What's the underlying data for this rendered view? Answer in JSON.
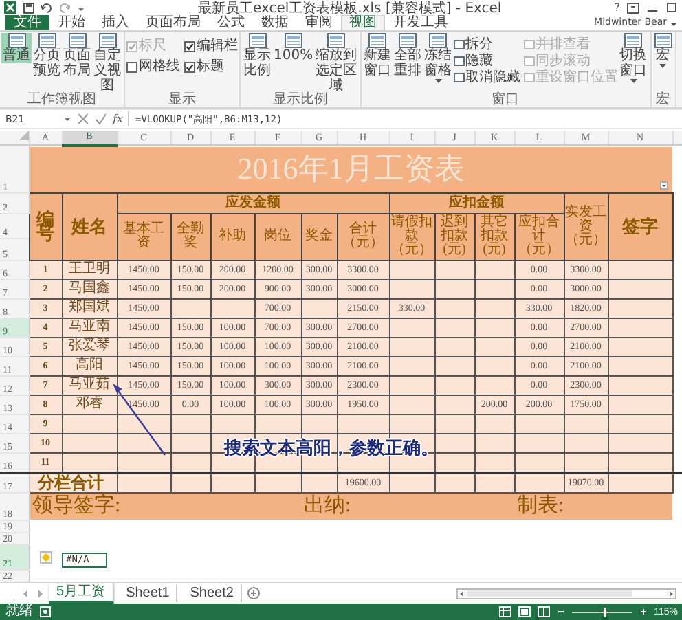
{
  "window": {
    "title": "最新员工excel工资表模板.xls  [兼容模式] - Excel",
    "help": "?"
  },
  "ribbon": {
    "tabs": [
      {
        "label": "文件",
        "kind": "file",
        "selected": false
      },
      {
        "label": "开始",
        "kind": "tab",
        "selected": false
      },
      {
        "label": "插入",
        "kind": "tab",
        "selected": false
      },
      {
        "label": "页面布局",
        "kind": "tab",
        "selected": false
      },
      {
        "label": "公式",
        "kind": "tab",
        "selected": false
      },
      {
        "label": "数据",
        "kind": "tab",
        "selected": false
      },
      {
        "label": "审阅",
        "kind": "tab",
        "selected": false
      },
      {
        "label": "视图",
        "kind": "tab",
        "selected": true
      },
      {
        "label": "开发工具",
        "kind": "tab",
        "selected": false
      }
    ],
    "account": "Midwinter Bear",
    "groups": [
      {
        "label": "工作簿视图",
        "items": [
          {
            "kind": "large",
            "label": "普通",
            "selected": true
          },
          {
            "kind": "large",
            "label": "分页预览",
            "selected": false
          },
          {
            "kind": "large",
            "label": "页面布局",
            "selected": false
          },
          {
            "kind": "large",
            "label": "自定义视图",
            "selected": false
          }
        ]
      },
      {
        "label": "显示",
        "items": [
          {
            "kind": "check",
            "label": "标尺",
            "checked": true,
            "disabled": true
          },
          {
            "kind": "check",
            "label": "编辑栏",
            "checked": true,
            "disabled": false
          },
          {
            "kind": "check",
            "label": "网格线",
            "checked": false,
            "disabled": false
          },
          {
            "kind": "check",
            "label": "标题",
            "checked": true,
            "disabled": false
          }
        ]
      },
      {
        "label": "显示比例",
        "items": [
          {
            "kind": "large",
            "label": "显示比例",
            "selected": false
          },
          {
            "kind": "large",
            "label": "100%",
            "selected": false
          },
          {
            "kind": "large",
            "label": "缩放到选定区域",
            "selected": false
          }
        ]
      },
      {
        "label": "窗口",
        "items": [
          {
            "kind": "large",
            "label": "新建窗口",
            "selected": false
          },
          {
            "kind": "large",
            "label": "全部重排",
            "selected": false
          },
          {
            "kind": "large",
            "label": "冻结窗格",
            "selected": false,
            "menu": true
          },
          {
            "kind": "small",
            "label": "拆分",
            "disabled": false
          },
          {
            "kind": "small",
            "label": "隐藏",
            "disabled": false
          },
          {
            "kind": "small",
            "label": "取消隐藏",
            "disabled": false
          },
          {
            "kind": "small",
            "label": "并排查看",
            "disabled": true
          },
          {
            "kind": "small",
            "label": "同步滚动",
            "disabled": true
          },
          {
            "kind": "small",
            "label": "重设窗口位置",
            "disabled": true
          },
          {
            "kind": "large",
            "label": "切换窗口",
            "selected": false,
            "menu": true
          }
        ]
      },
      {
        "label": "宏",
        "items": [
          {
            "kind": "large",
            "label": "宏",
            "selected": false,
            "menu": true
          }
        ]
      }
    ]
  },
  "formula_bar": {
    "name_box": "B21",
    "function_label": "fx",
    "formula": "=VLOOKUP(\"高阳\",B6:M13,12)"
  },
  "sheet": {
    "columns": [
      {
        "label": "A",
        "selected": false
      },
      {
        "label": "B",
        "selected": true
      },
      {
        "label": "C",
        "selected": false
      },
      {
        "label": "D",
        "selected": false
      },
      {
        "label": "E",
        "selected": false
      },
      {
        "label": "F",
        "selected": false
      },
      {
        "label": "G",
        "selected": false
      },
      {
        "label": "H",
        "selected": false
      },
      {
        "label": "I",
        "selected": false
      },
      {
        "label": "J",
        "selected": false
      },
      {
        "label": "K",
        "selected": false
      },
      {
        "label": "L",
        "selected": false
      },
      {
        "label": "M",
        "selected": false
      },
      {
        "label": "N",
        "selected": false
      }
    ],
    "title_row": {
      "number": "1",
      "title": "2016年1月工资表"
    },
    "header": {
      "row_numbers": [
        "2",
        "4",
        "5"
      ],
      "id_label": "编号",
      "name_label": "姓名",
      "pay_group": "应发金额",
      "deduct_group": "应扣金额",
      "net_label": "实发工资（元）",
      "sign_label": "签字",
      "pay_columns": [
        "基本工资",
        "全勤奖",
        "补助",
        "岗位",
        "奖金",
        "合计（元）"
      ],
      "deduct_columns": [
        "请假扣款（元）",
        "迟到扣款(元)",
        "其它扣款(元)",
        "应扣合计（元）"
      ]
    },
    "rows": [
      {
        "number": "6",
        "selected": false,
        "cells": [
          "1",
          "王卫明",
          "1450.00",
          "150.00",
          "200.00",
          "1200.00",
          "300.00",
          "3300.00",
          null,
          null,
          null,
          "0.00",
          "3300.00",
          null
        ]
      },
      {
        "number": "7",
        "selected": false,
        "cells": [
          "2",
          "马国鑫",
          "1450.00",
          "150.00",
          "200.00",
          "900.00",
          "300.00",
          "3000.00",
          null,
          null,
          null,
          "0.00",
          "3000.00",
          null
        ]
      },
      {
        "number": "8",
        "selected": false,
        "cells": [
          "3",
          "郑国斌",
          "1450.00",
          null,
          null,
          "700.00",
          null,
          "2150.00",
          "330.00",
          null,
          null,
          "330.00",
          "1820.00",
          null
        ]
      },
      {
        "number": "9",
        "selected": true,
        "cells": [
          "4",
          "马亚南",
          "1450.00",
          "150.00",
          "100.00",
          "700.00",
          "300.00",
          "2700.00",
          null,
          null,
          null,
          "0.00",
          "2700.00",
          null
        ]
      },
      {
        "number": "10",
        "selected": false,
        "cells": [
          "5",
          "张爱琴",
          "1450.00",
          "150.00",
          "100.00",
          "100.00",
          "300.00",
          "2100.00",
          null,
          null,
          null,
          "0.00",
          "2100.00",
          null
        ]
      },
      {
        "number": "11",
        "selected": false,
        "cells": [
          "6",
          "高阳",
          "1450.00",
          "150.00",
          "100.00",
          "100.00",
          "300.00",
          "2100.00",
          null,
          null,
          null,
          "0.00",
          "2100.00",
          null
        ]
      },
      {
        "number": "12",
        "selected": false,
        "cells": [
          "7",
          "马亚茹",
          "1450.00",
          "150.00",
          "100.00",
          "300.00",
          "300.00",
          "2300.00",
          null,
          null,
          null,
          "0.00",
          "2300.00",
          null
        ]
      },
      {
        "number": "13",
        "selected": false,
        "cells": [
          "8",
          "邓睿",
          "1450.00",
          "0.00",
          "100.00",
          "100.00",
          "300.00",
          "1950.00",
          null,
          null,
          "200.00",
          "200.00",
          "1750.00",
          null
        ]
      },
      {
        "number": "14",
        "selected": false,
        "cells": [
          "9",
          null,
          null,
          null,
          null,
          null,
          null,
          null,
          null,
          null,
          null,
          null,
          null,
          null
        ]
      },
      {
        "number": "15",
        "selected": false,
        "cells": [
          "10",
          null,
          null,
          null,
          null,
          null,
          null,
          null,
          null,
          null,
          null,
          null,
          null,
          null
        ]
      },
      {
        "number": "16",
        "selected": false,
        "cells": [
          "11",
          null,
          null,
          null,
          null,
          null,
          null,
          null,
          null,
          null,
          null,
          null,
          null,
          null
        ]
      }
    ],
    "total_row": {
      "number": "17",
      "label": "分栏合计",
      "cells": [
        null,
        null,
        null,
        null,
        null,
        "19600.00",
        null,
        null,
        null,
        null,
        "19070.00",
        null
      ]
    },
    "footer_row": {
      "number": "18",
      "labels": [
        "领导签字:",
        "出纳:",
        "制表:"
      ]
    },
    "blank_rows": [
      {
        "number": "19",
        "selected": false
      },
      {
        "number": "20",
        "selected": false
      },
      {
        "number": "21",
        "selected": true,
        "value": "#N/A"
      },
      {
        "number": "22",
        "selected": false
      }
    ]
  },
  "annotation": {
    "text": "搜索文本高阳，参数正确。"
  },
  "sheet_tabs": [
    {
      "label": "5月工资",
      "selected": true
    },
    {
      "label": "Sheet1",
      "selected": false
    },
    {
      "label": "Sheet2",
      "selected": false
    }
  ],
  "status_bar": {
    "status": "就绪",
    "zoom": {
      "level": 0.55,
      "reading": "115%"
    }
  }
}
